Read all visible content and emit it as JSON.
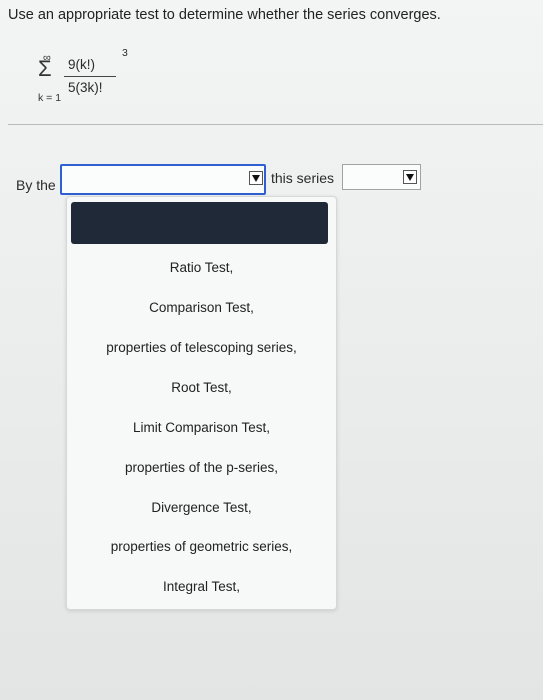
{
  "question": "Use an appropriate test to determine whether the series converges.",
  "series": {
    "sigma_upper": "∞",
    "sigma_symbol": "Σ",
    "sigma_lower": "k = 1",
    "numerator": "9(k!)",
    "numerator_exponent": "3",
    "denominator": "5(3k)!"
  },
  "answer": {
    "prefix": "By the",
    "middle": "this series",
    "test_select_value": "",
    "result_select_value": ""
  },
  "dropdown": {
    "selected_value": "",
    "options": [
      "Ratio Test,",
      "Comparison Test,",
      "properties of telescoping series,",
      "Root Test,",
      "Limit Comparison Test,",
      "properties of the p-series,",
      "Divergence Test,",
      "properties of geometric series,",
      "Integral Test,"
    ]
  },
  "colors": {
    "focus_border": "#2f5fd1",
    "highlight": "#1f2937"
  }
}
